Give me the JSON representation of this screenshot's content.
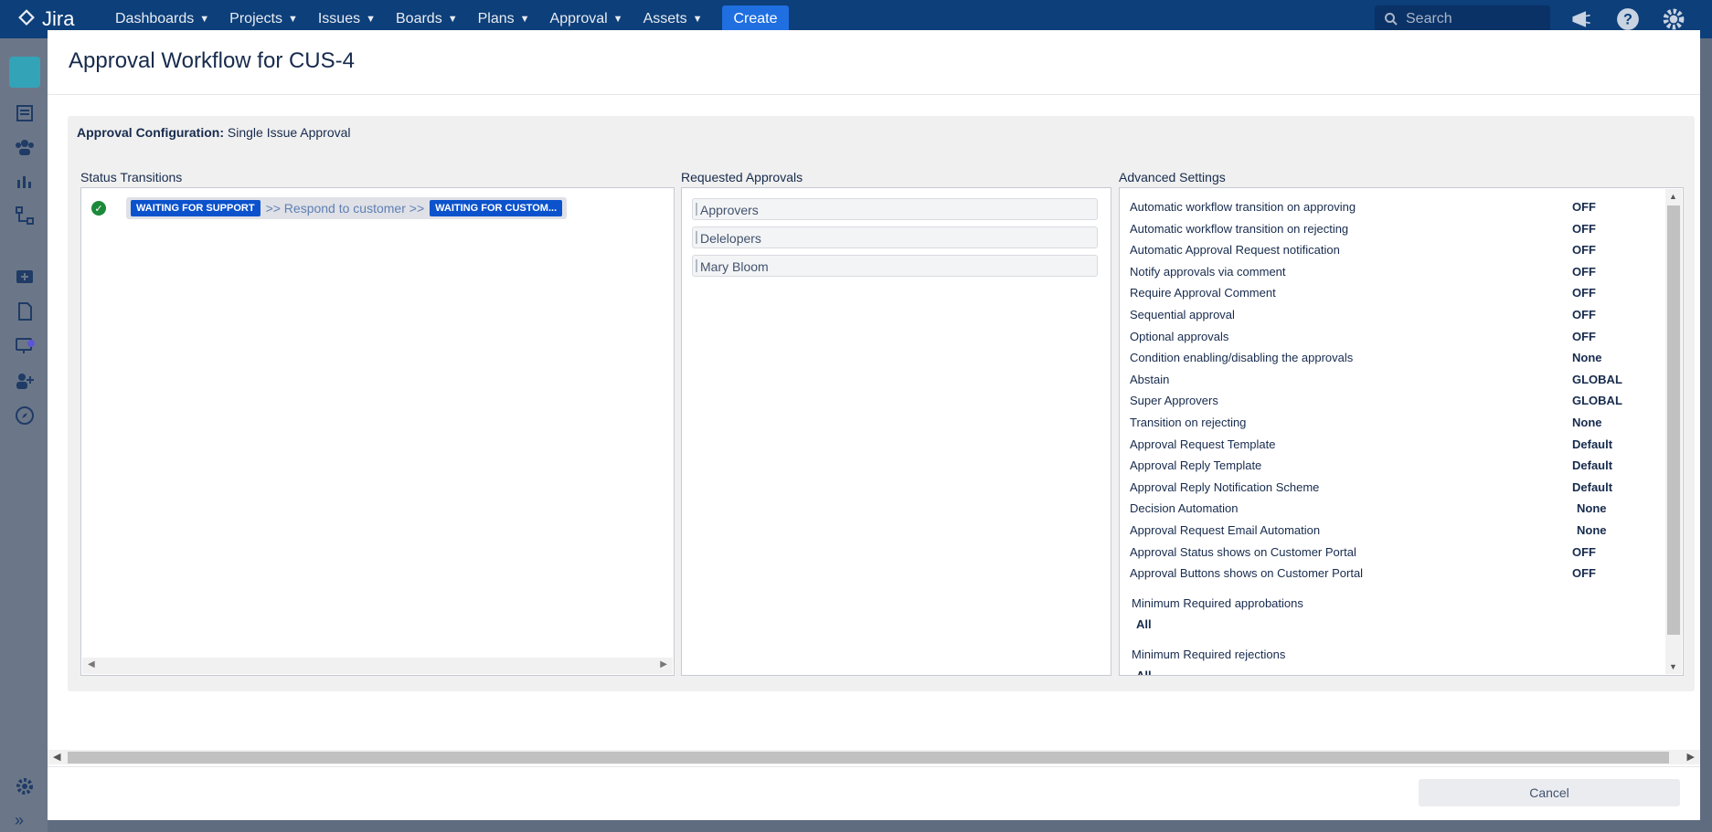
{
  "nav": {
    "brand": "Jira",
    "menu": [
      "Dashboards",
      "Projects",
      "Issues",
      "Boards",
      "Plans",
      "Approval",
      "Assets"
    ],
    "create_label": "Create",
    "search_placeholder": "Search"
  },
  "modal": {
    "title": "Approval Workflow for CUS-4",
    "config_label": "Approval Configuration:",
    "config_value": "Single Issue Approval",
    "status_transitions": {
      "heading": "Status Transitions",
      "from_status": "WAITING FOR SUPPORT",
      "transition_text": ">> Respond to customer >>",
      "to_status": "WAITING FOR CUSTOM..."
    },
    "requested_approvals": {
      "heading": "Requested Approvals",
      "items": [
        "Approvers",
        "Delelopers",
        "Mary Bloom"
      ]
    },
    "advanced_settings": {
      "heading": "Advanced Settings",
      "rows": [
        {
          "label": "Automatic workflow transition on approving",
          "value": "OFF"
        },
        {
          "label": "Automatic workflow transition on rejecting",
          "value": "OFF"
        },
        {
          "label": "Automatic Approval Request notification",
          "value": "OFF"
        },
        {
          "label": "Notify approvals via comment",
          "value": "OFF"
        },
        {
          "label": "Require Approval Comment",
          "value": "OFF"
        },
        {
          "label": "Sequential approval",
          "value": "OFF"
        },
        {
          "label": "Optional approvals",
          "value": "OFF"
        },
        {
          "label": "Condition enabling/disabling the approvals",
          "value": "None"
        },
        {
          "label": "Abstain",
          "value": "GLOBAL"
        },
        {
          "label": "Super Approvers",
          "value": "GLOBAL"
        },
        {
          "label": "Transition on rejecting",
          "value": "None"
        },
        {
          "label": "Approval Request Template",
          "value": "Default"
        },
        {
          "label": "Approval Reply Template",
          "value": "Default"
        },
        {
          "label": "Approval Reply Notification Scheme",
          "value": "Default"
        },
        {
          "label": "Decision Automation",
          "value": "None"
        },
        {
          "label": "Approval Request Email Automation",
          "value": "None"
        },
        {
          "label": "Approval Status shows on Customer Portal",
          "value": "OFF"
        },
        {
          "label": "Approval Buttons shows on Customer Portal",
          "value": "OFF"
        }
      ],
      "min_approbations_label": "Minimum Required approbations",
      "min_approbations_value": "All",
      "min_rejections_label": "Minimum Required rejections",
      "min_rejections_value": "All"
    },
    "cancel_label": "Cancel"
  }
}
